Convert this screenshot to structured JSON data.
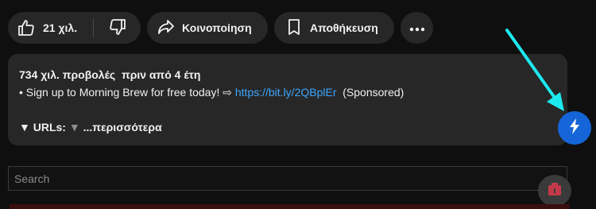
{
  "actions": {
    "like_count": "21 χιλ.",
    "share_label": "Κοινοποίηση",
    "save_label": "Αποθήκευση"
  },
  "description": {
    "views": "734 χιλ. προβολές",
    "age": "πριν από 4 έτη",
    "line_prefix": "• Sign up to Morning Brew for free today! ⇨",
    "link": "https://bit.ly/2QBplEr",
    "sponsored": "(Sponsored)",
    "urls_label": "▼ URLs:",
    "urls_triangle": "▼",
    "more_label": "...περισσότερα"
  },
  "search": {
    "placeholder": "Search"
  },
  "colors": {
    "background": "#0f0f0f",
    "pill": "#272727",
    "link": "#3ea6ff",
    "fab": "#1565d8",
    "arrow": "#1de9f0"
  },
  "icons": [
    "thumbs-up-icon",
    "thumbs-down-icon",
    "share-arrow-icon",
    "bookmark-icon",
    "more-dots-icon",
    "lightning-icon",
    "pointer-arrow-icon",
    "extension-icon"
  ]
}
